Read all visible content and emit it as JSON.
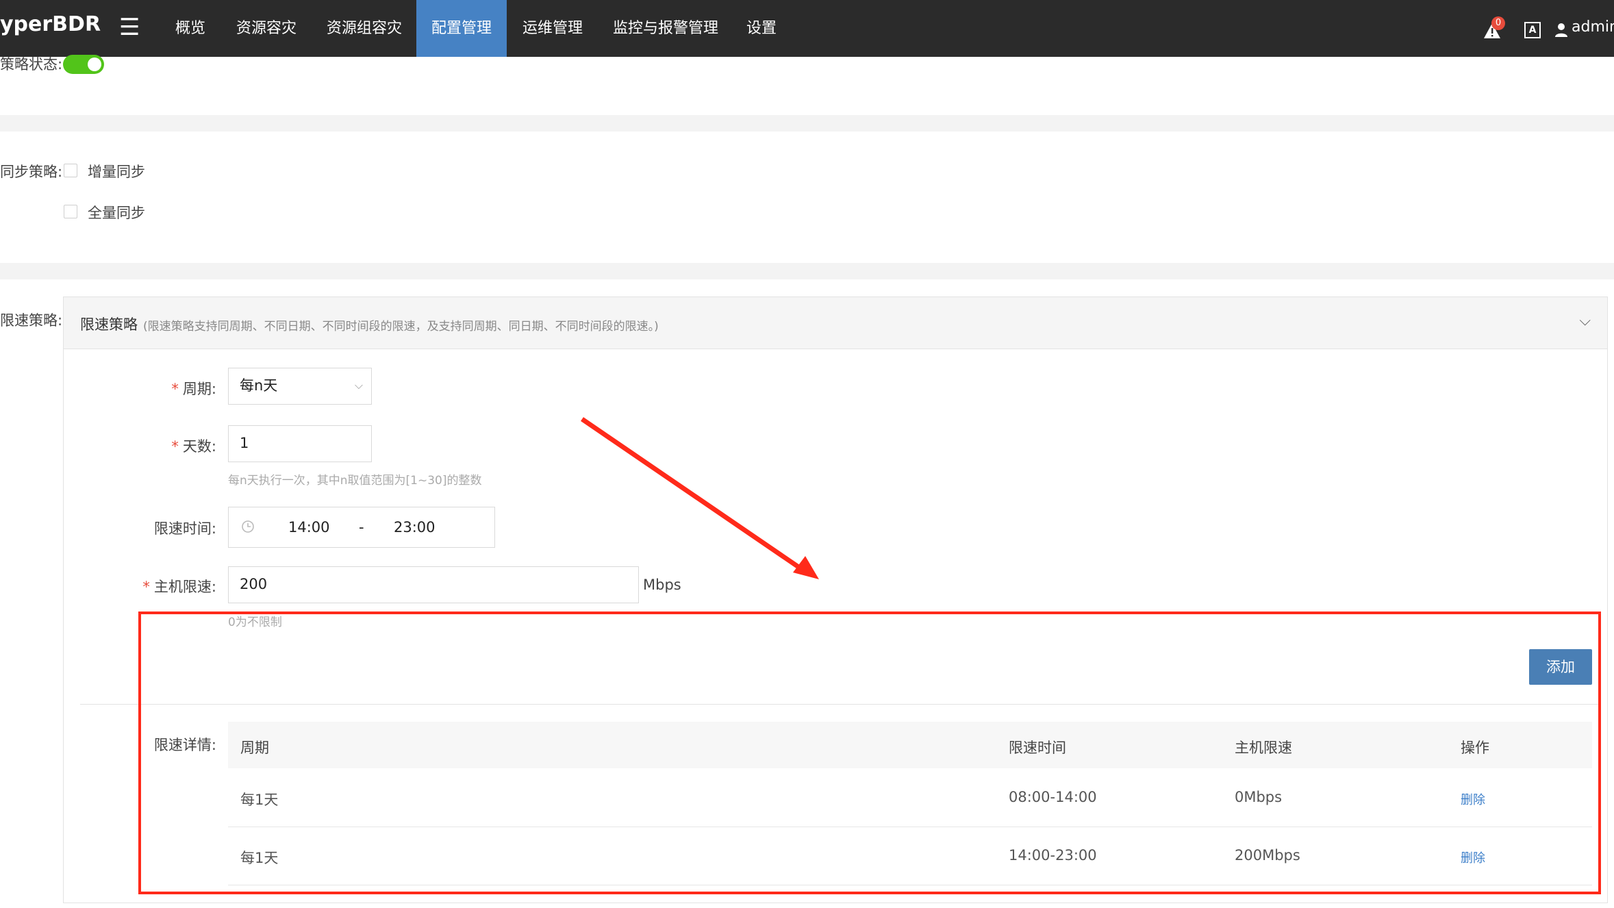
{
  "brand": "yperBDR",
  "nav": {
    "items": [
      {
        "label": "概览"
      },
      {
        "label": "资源容灾"
      },
      {
        "label": "资源组容灾"
      },
      {
        "label": "配置管理"
      },
      {
        "label": "运维管理"
      },
      {
        "label": "监控与报警管理"
      },
      {
        "label": "设置"
      }
    ],
    "active": "配置管理",
    "alert_count": "0",
    "lang_icon_text": "A",
    "user": "admin"
  },
  "strategy_status": {
    "label": "策略状态:",
    "enabled": true
  },
  "sync_strategy": {
    "label": "同步策略:",
    "options": [
      {
        "label": "增量同步",
        "checked": false
      },
      {
        "label": "全量同步",
        "checked": false
      }
    ]
  },
  "limit_strategy": {
    "label": "限速策略:",
    "panel_title": "限速策略",
    "panel_hint": "(限速策略支持同周期、不同日期、不同时间段的限速，及支持同周期、同日期、不同时间段的限速。)",
    "fields": {
      "period_label": "周期:",
      "period_value": "每n天",
      "days_label": "天数:",
      "days_value": "1",
      "days_help": "每n天执行一次，其中n取值范围为[1~30]的整数",
      "time_label": "限速时间:",
      "time_start": "14:00",
      "time_sep": "-",
      "time_end": "23:00",
      "host_limit_label": "主机限速:",
      "host_limit_value": "200",
      "host_limit_unit": "Mbps",
      "host_limit_help": "0为不限制"
    },
    "add_button": "添加",
    "details_label": "限速详情:",
    "table": {
      "headers": [
        "周期",
        "限速时间",
        "主机限速",
        "操作"
      ],
      "rows": [
        {
          "period": "每1天",
          "time": "08:00-14:00",
          "limit": "0Mbps",
          "action": "删除"
        },
        {
          "period": "每1天",
          "time": "14:00-23:00",
          "limit": "200Mbps",
          "action": "删除"
        }
      ]
    }
  },
  "annotation_color": "#ff2a1a",
  "accent_color": "#4682c4"
}
